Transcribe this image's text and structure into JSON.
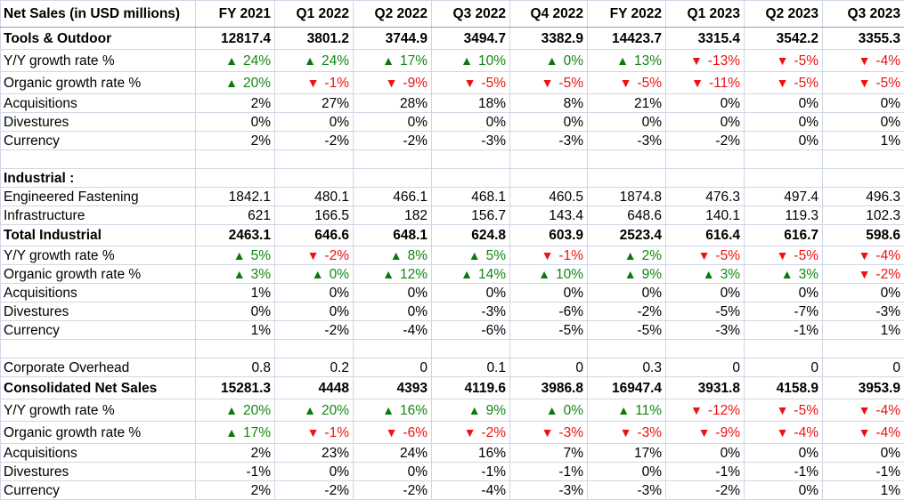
{
  "header": {
    "label": "Net Sales (in USD  millions)",
    "periods": [
      "FY 2021",
      "Q1 2022",
      "Q2 2022",
      "Q3 2022",
      "Q4 2022",
      "FY 2022",
      "Q1 2023",
      "Q2 2023",
      "Q3 2023"
    ]
  },
  "icons": {
    "up": "▲",
    "down": "▼"
  },
  "colors": {
    "up": "#118811",
    "down": "#ee1111",
    "grid": "#d0d7e5"
  },
  "rows": [
    {
      "label": "Tools & Outdoor",
      "type": "bold",
      "h": "big",
      "values": [
        "12817.4",
        "3801.2",
        "3744.9",
        "3494.7",
        "3382.9",
        "14423.7",
        "3315.4",
        "3542.2",
        "3355.3"
      ]
    },
    {
      "label": "Y/Y growth rate %",
      "type": "trend",
      "h": "big",
      "values": [
        "24%",
        "24%",
        "17%",
        "10%",
        "0%",
        "13%",
        "-13%",
        "-5%",
        "-4%"
      ],
      "dirs": [
        "up",
        "up",
        "up",
        "up",
        "up",
        "up",
        "down",
        "down",
        "down"
      ]
    },
    {
      "label": "Organic growth rate %",
      "type": "trend",
      "h": "big",
      "values": [
        "20%",
        "-1%",
        "-9%",
        "-5%",
        "-5%",
        "-5%",
        "-11%",
        "-5%",
        "-5%"
      ],
      "dirs": [
        "up",
        "down",
        "down",
        "down",
        "down",
        "down",
        "down",
        "down",
        "down"
      ]
    },
    {
      "label": "Acquisitions",
      "type": "plain",
      "h": "sm",
      "values": [
        "2%",
        "27%",
        "28%",
        "18%",
        "8%",
        "21%",
        "0%",
        "0%",
        "0%"
      ]
    },
    {
      "label": "Divestures",
      "type": "plain",
      "h": "sm",
      "values": [
        "0%",
        "0%",
        "0%",
        "0%",
        "0%",
        "0%",
        "0%",
        "0%",
        "0%"
      ]
    },
    {
      "label": "Currency",
      "type": "plain",
      "h": "sm",
      "values": [
        "2%",
        "-2%",
        "-2%",
        "-3%",
        "-3%",
        "-3%",
        "-2%",
        "0%",
        "1%"
      ]
    },
    {
      "label": "",
      "type": "blank",
      "h": "sm",
      "values": [
        "",
        "",
        "",
        "",
        "",
        "",
        "",
        "",
        ""
      ]
    },
    {
      "label": "Industrial :",
      "type": "bold",
      "h": "sm",
      "values": [
        "",
        "",
        "",
        "",
        "",
        "",
        "",
        "",
        ""
      ]
    },
    {
      "label": "Engineered Fastening",
      "type": "plain",
      "h": "sm",
      "values": [
        "1842.1",
        "480.1",
        "466.1",
        "468.1",
        "460.5",
        "1874.8",
        "476.3",
        "497.4",
        "496.3"
      ]
    },
    {
      "label": "Infrastructure",
      "type": "plain",
      "h": "sm",
      "values": [
        "621",
        "166.5",
        "182",
        "156.7",
        "143.4",
        "648.6",
        "140.1",
        "119.3",
        "102.3"
      ]
    },
    {
      "label": "Total Industrial",
      "type": "bold",
      "h": "mid",
      "values": [
        "2463.1",
        "646.6",
        "648.1",
        "624.8",
        "603.9",
        "2523.4",
        "616.4",
        "616.7",
        "598.6"
      ]
    },
    {
      "label": "Y/Y growth rate %",
      "type": "trend",
      "h": "sm",
      "values": [
        "5%",
        "-2%",
        "8%",
        "5%",
        "-1%",
        "2%",
        "-5%",
        "-5%",
        "-4%"
      ],
      "dirs": [
        "up",
        "down",
        "up",
        "up",
        "down",
        "up",
        "down",
        "down",
        "down"
      ]
    },
    {
      "label": "Organic growth rate %",
      "type": "trend",
      "h": "sm",
      "values": [
        "3%",
        "0%",
        "12%",
        "14%",
        "10%",
        "9%",
        "3%",
        "3%",
        "-2%"
      ],
      "dirs": [
        "up",
        "up",
        "up",
        "up",
        "up",
        "up",
        "up",
        "up",
        "down"
      ]
    },
    {
      "label": "Acquisitions",
      "type": "plain",
      "h": "sm",
      "values": [
        "1%",
        "0%",
        "0%",
        "0%",
        "0%",
        "0%",
        "0%",
        "0%",
        "0%"
      ]
    },
    {
      "label": "Divestures",
      "type": "plain",
      "h": "sm",
      "values": [
        "0%",
        "0%",
        "0%",
        "-3%",
        "-6%",
        "-2%",
        "-5%",
        "-7%",
        "-3%"
      ]
    },
    {
      "label": "Currency",
      "type": "plain",
      "h": "sm",
      "values": [
        "1%",
        "-2%",
        "-4%",
        "-6%",
        "-5%",
        "-5%",
        "-3%",
        "-1%",
        "1%"
      ]
    },
    {
      "label": "",
      "type": "blank",
      "h": "sm",
      "values": [
        "",
        "",
        "",
        "",
        "",
        "",
        "",
        "",
        ""
      ]
    },
    {
      "label": "Corporate Overhead",
      "type": "plain",
      "h": "sm",
      "values": [
        "0.8",
        "0.2",
        "0",
        "0.1",
        "0",
        "0.3",
        "0",
        "0",
        "0"
      ]
    },
    {
      "label": "Consolidated Net Sales",
      "type": "bold",
      "h": "big",
      "values": [
        "15281.3",
        "4448",
        "4393",
        "4119.6",
        "3986.8",
        "16947.4",
        "3931.8",
        "4158.9",
        "3953.9"
      ]
    },
    {
      "label": "Y/Y growth rate %",
      "type": "trend",
      "h": "big",
      "values": [
        "20%",
        "20%",
        "16%",
        "9%",
        "0%",
        "11%",
        "-12%",
        "-5%",
        "-4%"
      ],
      "dirs": [
        "up",
        "up",
        "up",
        "up",
        "up",
        "up",
        "down",
        "down",
        "down"
      ]
    },
    {
      "label": "Organic growth rate %",
      "type": "trend",
      "h": "big",
      "values": [
        "17%",
        "-1%",
        "-6%",
        "-2%",
        "-3%",
        "-3%",
        "-9%",
        "-4%",
        "-4%"
      ],
      "dirs": [
        "up",
        "down",
        "down",
        "down",
        "down",
        "down",
        "down",
        "down",
        "down"
      ]
    },
    {
      "label": "Acquisitions",
      "type": "plain",
      "h": "sm",
      "values": [
        "2%",
        "23%",
        "24%",
        "16%",
        "7%",
        "17%",
        "0%",
        "0%",
        "0%"
      ]
    },
    {
      "label": "Divestures",
      "type": "plain",
      "h": "sm",
      "values": [
        "-1%",
        "0%",
        "0%",
        "-1%",
        "-1%",
        "0%",
        "-1%",
        "-1%",
        "-1%"
      ]
    },
    {
      "label": "Currency",
      "type": "plain",
      "h": "sm",
      "values": [
        "2%",
        "-2%",
        "-2%",
        "-4%",
        "-3%",
        "-3%",
        "-2%",
        "0%",
        "1%"
      ]
    }
  ]
}
